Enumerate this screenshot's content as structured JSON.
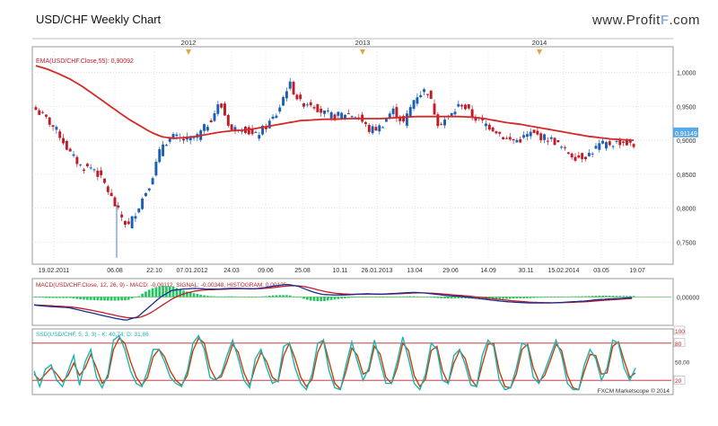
{
  "header": {
    "title": "USD/CHF Weekly Chart",
    "brand_prefix": "www.Profit",
    "brand_mark": "F",
    "brand_suffix": ".com"
  },
  "chart_data": [
    {
      "type": "candlestick",
      "year_markers": [
        "2012",
        "2013",
        "2014"
      ],
      "legend": "EMA(USD/CHF.Close,55): 0,90092",
      "ylim": [
        0.72,
        1.03
      ],
      "y_ticks": [
        {
          "v": 1.0,
          "label": "1,0000"
        },
        {
          "v": 0.95,
          "label": "0,9500"
        },
        {
          "v": 0.9,
          "label": "0,9000"
        },
        {
          "v": 0.85,
          "label": "0,8500"
        },
        {
          "v": 0.8,
          "label": "0,8000"
        },
        {
          "v": 0.75,
          "label": "0,7500"
        }
      ],
      "current_price": "0,91149",
      "x_ticks": [
        "19.02.2011",
        "06.08",
        "22.10",
        "07.01.2012",
        "24.03",
        "09.06",
        "25.08",
        "10.11",
        "26.01.2013",
        "13.04",
        "29.06",
        "14.09",
        "30.11",
        "15.02.2014",
        "03.05",
        "19.07"
      ],
      "close_anchors": [
        0.945,
        0.93,
        0.91,
        0.88,
        0.86,
        0.86,
        0.835,
        0.8,
        0.772,
        0.805,
        0.84,
        0.895,
        0.905,
        0.9,
        0.905,
        0.925,
        0.955,
        0.915,
        0.92,
        0.905,
        0.92,
        0.94,
        0.985,
        0.955,
        0.955,
        0.94,
        0.935,
        0.94,
        0.935,
        0.915,
        0.92,
        0.945,
        0.925,
        0.965,
        0.975,
        0.925,
        0.935,
        0.955,
        0.935,
        0.925,
        0.915,
        0.9,
        0.9,
        0.91,
        0.905,
        0.9,
        0.885,
        0.875,
        0.878,
        0.893,
        0.895,
        0.898,
        0.891
      ],
      "ema_anchors": [
        1.01,
        1.005,
        0.998,
        0.99,
        0.98,
        0.968,
        0.956,
        0.944,
        0.932,
        0.922,
        0.912,
        0.905,
        0.903,
        0.904,
        0.906,
        0.909,
        0.912,
        0.914,
        0.915,
        0.917,
        0.92,
        0.923,
        0.926,
        0.929,
        0.93,
        0.931,
        0.931,
        0.932,
        0.932,
        0.932,
        0.932,
        0.933,
        0.934,
        0.935,
        0.935,
        0.935,
        0.935,
        0.935,
        0.934,
        0.932,
        0.929,
        0.926,
        0.924,
        0.921,
        0.918,
        0.915,
        0.912,
        0.909,
        0.906,
        0.904,
        0.902,
        0.901,
        0.9
      ],
      "up_color": "#1a5fb4",
      "down_color": "#c01c28",
      "ema_color": "#d62828"
    },
    {
      "type": "line",
      "legend": "MACD(USD/CHF.Close, 12, 26, 9) - MACD: -0,00112, SIGNAL: -0,00348, HISTOGRAM: 0,00135",
      "ylim": [
        -0.04,
        0.025
      ],
      "y_ticks": [
        {
          "v": 0.0,
          "label": "0,00000"
        }
      ],
      "macd_anchors": [
        -0.012,
        -0.014,
        -0.015,
        -0.016,
        -0.02,
        -0.024,
        -0.028,
        -0.032,
        -0.035,
        -0.03,
        -0.015,
        0.0,
        0.01,
        0.012,
        0.013,
        0.012,
        0.012,
        0.013,
        0.013,
        0.012,
        0.014,
        0.017,
        0.019,
        0.016,
        0.009,
        0.004,
        0.003,
        0.003,
        0.004,
        0.005,
        0.004,
        0.005,
        0.006,
        0.007,
        0.006,
        0.004,
        0.002,
        0.001,
        -0.001,
        -0.003,
        -0.005,
        -0.007,
        -0.008,
        -0.009,
        -0.009,
        -0.009,
        -0.008,
        -0.007,
        -0.006,
        -0.004,
        -0.003,
        -0.002,
        -0.001
      ],
      "macd_color": "#1c2b8f",
      "signal_color": "#c01c28",
      "histogram_color": "#22c55e"
    },
    {
      "type": "line",
      "legend": "SSD(USD/CHF, 5, 3, 3) - K: 40,74; D: 31,86",
      "ylim": [
        0,
        100
      ],
      "y_ticks": [
        {
          "v": 100,
          "label": "100"
        },
        {
          "v": 80,
          "label": "80"
        },
        {
          "v": 50,
          "label": "50,00"
        },
        {
          "v": 20,
          "label": "20"
        }
      ],
      "reference_lines": [
        80,
        20
      ],
      "k_points": [
        35,
        10,
        38,
        45,
        20,
        10,
        35,
        60,
        12,
        50,
        70,
        25,
        8,
        30,
        85,
        92,
        70,
        35,
        15,
        10,
        35,
        70,
        70,
        50,
        25,
        15,
        10,
        35,
        80,
        92,
        70,
        25,
        20,
        30,
        60,
        85,
        55,
        20,
        8,
        55,
        70,
        40,
        15,
        20,
        75,
        80,
        40,
        15,
        5,
        30,
        80,
        85,
        35,
        8,
        5,
        45,
        82,
        50,
        20,
        40,
        85,
        50,
        15,
        15,
        50,
        90,
        55,
        15,
        5,
        30,
        80,
        70,
        20,
        15,
        60,
        70,
        45,
        12,
        10,
        60,
        85,
        75,
        20,
        5,
        8,
        40,
        80,
        75,
        25,
        15,
        35,
        60,
        85,
        60,
        15,
        5,
        5,
        45,
        70,
        55,
        20,
        40,
        85,
        80,
        40,
        20,
        40
      ],
      "d_points": [
        30,
        20,
        30,
        40,
        30,
        18,
        28,
        48,
        28,
        40,
        62,
        40,
        15,
        25,
        70,
        88,
        80,
        50,
        25,
        12,
        25,
        58,
        70,
        58,
        35,
        20,
        12,
        28,
        68,
        88,
        80,
        40,
        22,
        26,
        50,
        78,
        65,
        32,
        12,
        42,
        65,
        50,
        25,
        18,
        60,
        80,
        55,
        25,
        10,
        22,
        65,
        85,
        50,
        15,
        6,
        35,
        72,
        60,
        30,
        35,
        75,
        62,
        25,
        15,
        40,
        80,
        68,
        28,
        10,
        22,
        68,
        75,
        35,
        15,
        48,
        68,
        55,
        22,
        10,
        45,
        78,
        80,
        35,
        10,
        8,
        30,
        70,
        78,
        40,
        18,
        28,
        52,
        78,
        68,
        28,
        8,
        5,
        35,
        62,
        60,
        30,
        32,
        75,
        82,
        52,
        25,
        32
      ],
      "k_color": "#1ab3b3",
      "d_color": "#c2410c",
      "ref_color": "#c01c28"
    }
  ],
  "footer": {
    "copyright": "FXCM Marketscope © 2014"
  }
}
